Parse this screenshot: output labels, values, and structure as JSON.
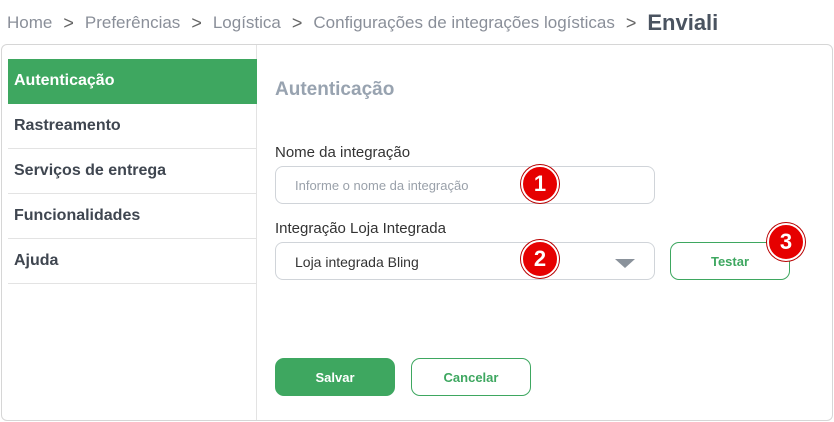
{
  "breadcrumb": {
    "items": [
      "Home",
      "Preferências",
      "Logística",
      "Configurações de integrações logísticas"
    ],
    "separator": ">",
    "current": "Enviali"
  },
  "sidebar": {
    "items": [
      {
        "label": "Autenticação",
        "active": true
      },
      {
        "label": "Rastreamento",
        "active": false
      },
      {
        "label": "Serviços de entrega",
        "active": false
      },
      {
        "label": "Funcionalidades",
        "active": false
      },
      {
        "label": "Ajuda",
        "active": false
      }
    ]
  },
  "main": {
    "title": "Autenticação",
    "integration_name": {
      "label": "Nome da integração",
      "placeholder": "Informe o nome da integração",
      "value": ""
    },
    "loja_integrada": {
      "label": "Integração Loja Integrada",
      "selected": "Loja integrada Bling"
    },
    "test_button": "Testar",
    "save_button": "Salvar",
    "cancel_button": "Cancelar"
  },
  "markers": [
    "1",
    "2",
    "3"
  ],
  "colors": {
    "accent": "#3ea760",
    "marker": "#e60000"
  }
}
